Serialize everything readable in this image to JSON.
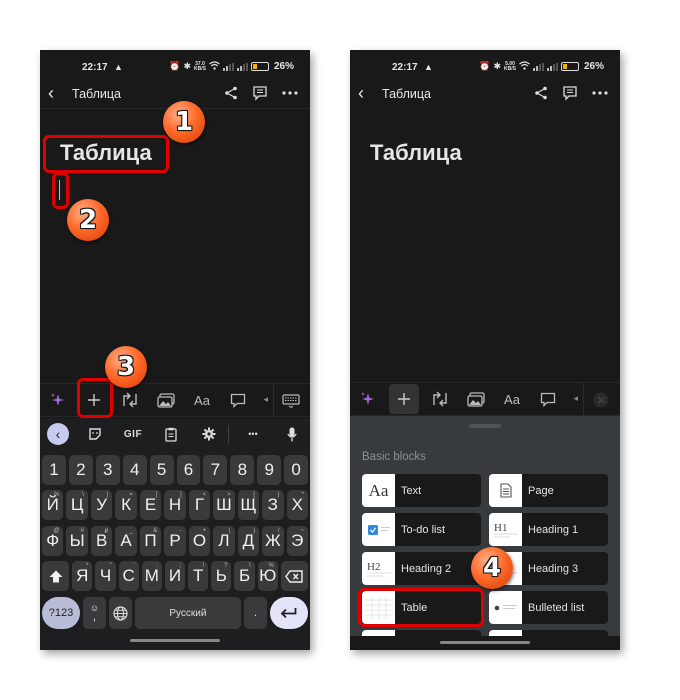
{
  "screens": {
    "left": {
      "status": {
        "time": "22:17",
        "speed": "37.0\nKB/S",
        "battery": "26%"
      },
      "appbar": {
        "title": "Таблица"
      },
      "doc": {
        "title": "Таблица"
      },
      "toolbar": {
        "items": [
          "ai-sparkle",
          "add-block",
          "turn-into",
          "media",
          "text-style",
          "comment",
          "keyboard-hide"
        ],
        "text_style_label": "Aa"
      },
      "keyboard": {
        "strip": {
          "gif_label": "GIF",
          "more_label": "•••"
        },
        "rows": {
          "numbers": [
            "1",
            "2",
            "3",
            "4",
            "5",
            "6",
            "7",
            "8",
            "9",
            "0"
          ],
          "row1": [
            {
              "k": "Й",
              "s": "%"
            },
            {
              "k": "Ц",
              "s": "\\"
            },
            {
              "k": "У",
              "s": "|"
            },
            {
              "k": "К",
              "s": "="
            },
            {
              "k": "Е",
              "s": "["
            },
            {
              "k": "Н",
              "s": "]"
            },
            {
              "k": "Г",
              "s": "<"
            },
            {
              "k": "Ш",
              "s": ">"
            },
            {
              "k": "Щ",
              "s": "{"
            },
            {
              "k": "З",
              "s": "}"
            },
            {
              "k": "Х",
              "s": "*"
            }
          ],
          "row2": [
            {
              "k": "Ф",
              "s": "@"
            },
            {
              "k": "Ы",
              "s": "#"
            },
            {
              "k": "В",
              "s": "₽"
            },
            {
              "k": "А",
              "s": "_"
            },
            {
              "k": "П",
              "s": "&"
            },
            {
              "k": "Р",
              "s": "-"
            },
            {
              "k": "О",
              "s": "+"
            },
            {
              "k": "Л",
              "s": "("
            },
            {
              "k": "Д",
              "s": ")"
            },
            {
              "k": "Ж",
              "s": "/"
            },
            {
              "k": "Э",
              "s": "~"
            }
          ],
          "row3": [
            {
              "k": "Я",
              "s": "*"
            },
            {
              "k": "Ч",
              "s": "\""
            },
            {
              "k": "С",
              "s": "'"
            },
            {
              "k": "М",
              "s": ":"
            },
            {
              "k": "И",
              "s": ";"
            },
            {
              "k": "Т",
              "s": "!"
            },
            {
              "k": "Ь",
              "s": "?"
            },
            {
              "k": "Б",
              "s": "\\"
            },
            {
              "k": "Ю",
              "s": "%"
            }
          ],
          "bottom": {
            "symbols": "?123",
            "comma": ",",
            "space": "Русский",
            "period": "."
          }
        }
      }
    },
    "right": {
      "status": {
        "time": "22:17",
        "speed": "5.00\nKB/S",
        "battery": "26%"
      },
      "appbar": {
        "title": "Таблица"
      },
      "doc": {
        "title": "Таблица"
      },
      "toolbar": {
        "text_style_label": "Aa"
      },
      "sheet": {
        "section_label": "Basic blocks",
        "blocks": [
          {
            "label": "Text",
            "icon": "text-aa-icon"
          },
          {
            "label": "Page",
            "icon": "page-icon"
          },
          {
            "label": "To-do list",
            "icon": "todo-icon"
          },
          {
            "label": "Heading 1",
            "icon": "heading1-icon"
          },
          {
            "label": "Heading 2",
            "icon": "heading2-icon"
          },
          {
            "label": "Heading 3",
            "icon": "heading3-icon"
          },
          {
            "label": "Table",
            "icon": "table-icon"
          },
          {
            "label": "Bulleted list",
            "icon": "bulleted-list-icon"
          }
        ]
      }
    }
  },
  "annotations": {
    "steps": [
      "1",
      "2",
      "3",
      "4"
    ],
    "highlight_color": "#e00000",
    "badge_color": "#ff6a2a"
  }
}
